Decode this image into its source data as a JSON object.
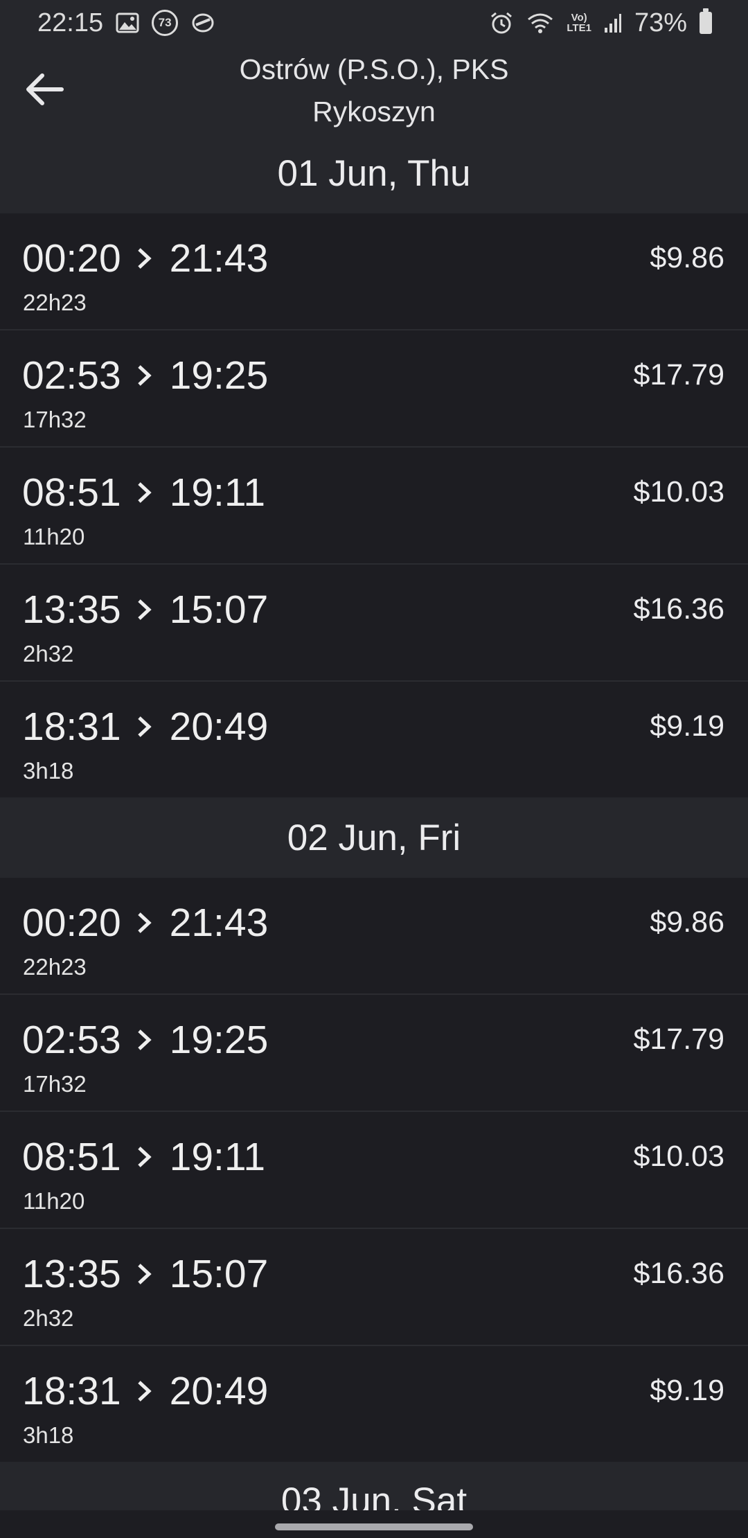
{
  "status": {
    "time": "22:15",
    "notif_badge": "73",
    "network": "Vo)\nLTE1",
    "battery": "73%"
  },
  "header": {
    "title_line1": "Ostrów (P.S.O.), PKS",
    "title_line2": "Rykoszyn",
    "back_icon": "arrow-left-icon"
  },
  "days": [
    {
      "date": "01 Jun, Thu",
      "trips": [
        {
          "depart": "00:20",
          "arrive": "21:43",
          "duration": "22h23",
          "price": "$9.86"
        },
        {
          "depart": "02:53",
          "arrive": "19:25",
          "duration": "17h32",
          "price": "$17.79"
        },
        {
          "depart": "08:51",
          "arrive": "19:11",
          "duration": "11h20",
          "price": "$10.03"
        },
        {
          "depart": "13:35",
          "arrive": "15:07",
          "duration": "2h32",
          "price": "$16.36"
        },
        {
          "depart": "18:31",
          "arrive": "20:49",
          "duration": "3h18",
          "price": "$9.19"
        }
      ]
    },
    {
      "date": "02 Jun, Fri",
      "trips": [
        {
          "depart": "00:20",
          "arrive": "21:43",
          "duration": "22h23",
          "price": "$9.86"
        },
        {
          "depart": "02:53",
          "arrive": "19:25",
          "duration": "17h32",
          "price": "$17.79"
        },
        {
          "depart": "08:51",
          "arrive": "19:11",
          "duration": "11h20",
          "price": "$10.03"
        },
        {
          "depart": "13:35",
          "arrive": "15:07",
          "duration": "2h32",
          "price": "$16.36"
        },
        {
          "depart": "18:31",
          "arrive": "20:49",
          "duration": "3h18",
          "price": "$9.19"
        }
      ]
    },
    {
      "date": "03 Jun, Sat",
      "trips": []
    }
  ]
}
